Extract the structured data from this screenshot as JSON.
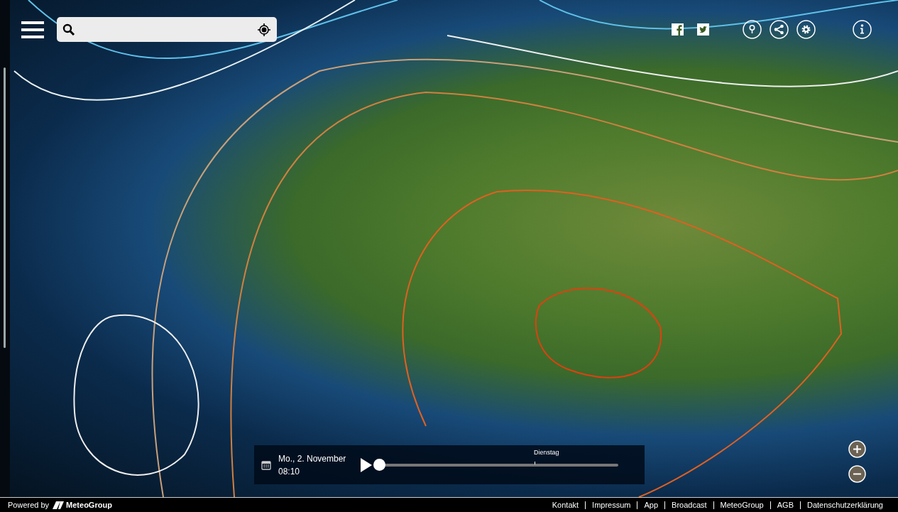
{
  "timeline": {
    "date": "Mo., 2. November",
    "time": "08:10",
    "day_marker": "Dienstag",
    "level": 0
  },
  "footer": {
    "powered_by": "Powered by",
    "logo": "MeteoGroup",
    "links": [
      "Kontakt",
      "Impressum",
      "App",
      "Broadcast",
      "MeteoGroup",
      "AGB",
      "Datenschutzerklärung"
    ]
  }
}
